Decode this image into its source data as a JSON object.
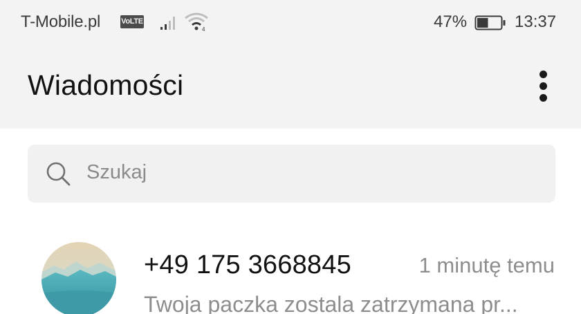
{
  "status_bar": {
    "carrier": "T-Mobile.pl",
    "volte_badge": "VoLTE",
    "battery_percent": "47%",
    "battery_level": 0.47,
    "time": "13:37"
  },
  "app_bar": {
    "title": "Wiadomości",
    "menu_icon": "more-vert-icon"
  },
  "search": {
    "placeholder": "Szukaj",
    "icon": "search-icon"
  },
  "conversations": [
    {
      "sender": "+49 175 3668845",
      "time": "1 minutę temu",
      "preview": "Twoja paczka zostala zatrzymana pr..."
    }
  ],
  "colors": {
    "header_background": "#f3f3f3",
    "search_background": "#f1f1f1",
    "secondary_text": "#8d8d8d"
  }
}
